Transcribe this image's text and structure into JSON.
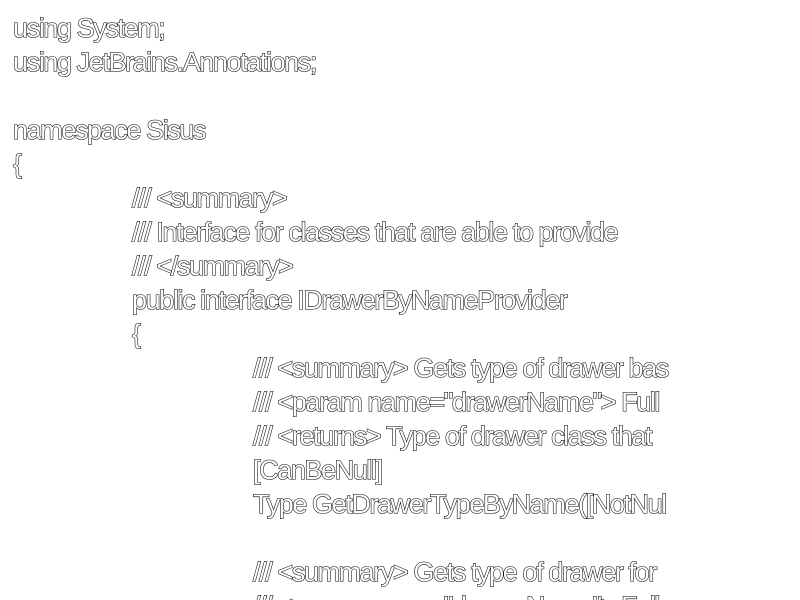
{
  "code": {
    "lines": [
      "using System;",
      "using JetBrains.Annotations;",
      "",
      "namespace Sisus",
      "{",
      "/// <summary>",
      "/// Interface for classes that are able to provide",
      "/// </summary>",
      "public interface IDrawerByNameProvider",
      "{",
      "/// <summary> Gets type of drawer bas",
      "/// <param name=\"drawerName\"> Full",
      "/// <returns> Type of drawer class that",
      "[CanBeNull]",
      "Type GetDrawerTypeByName([NotNul",
      "",
      "/// <summary> Gets type of drawer for",
      "/// <param name=\"drawerName\"> Full"
    ]
  }
}
